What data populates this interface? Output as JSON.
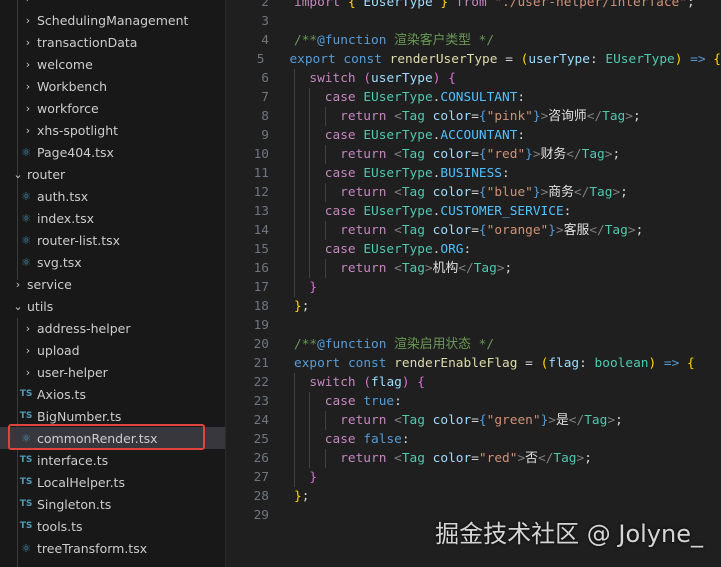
{
  "explorer": {
    "items": [
      {
        "label": "",
        "kind": "folder",
        "level": 2,
        "open": false
      },
      {
        "label": "SchedulingManagement",
        "kind": "folder",
        "level": 2,
        "open": false
      },
      {
        "label": "transactionData",
        "kind": "folder",
        "level": 2,
        "open": false
      },
      {
        "label": "welcome",
        "kind": "folder",
        "level": 2,
        "open": false
      },
      {
        "label": "Workbench",
        "kind": "folder",
        "level": 2,
        "open": false
      },
      {
        "label": "workforce",
        "kind": "folder",
        "level": 2,
        "open": false
      },
      {
        "label": "xhs-spotlight",
        "kind": "folder",
        "level": 2,
        "open": false
      },
      {
        "label": "Page404.tsx",
        "kind": "react",
        "level": 2
      },
      {
        "label": "router",
        "kind": "folder",
        "level": 1,
        "open": true
      },
      {
        "label": "auth.tsx",
        "kind": "react",
        "level": 2
      },
      {
        "label": "index.tsx",
        "kind": "react",
        "level": 2
      },
      {
        "label": "router-list.tsx",
        "kind": "react",
        "level": 2
      },
      {
        "label": "svg.tsx",
        "kind": "react",
        "level": 2
      },
      {
        "label": "service",
        "kind": "folder",
        "level": 1,
        "open": false
      },
      {
        "label": "utils",
        "kind": "folder",
        "level": 1,
        "open": true
      },
      {
        "label": "address-helper",
        "kind": "folder",
        "level": 2,
        "open": false
      },
      {
        "label": "upload",
        "kind": "folder",
        "level": 2,
        "open": false
      },
      {
        "label": "user-helper",
        "kind": "folder",
        "level": 2,
        "open": false
      },
      {
        "label": "Axios.ts",
        "kind": "ts",
        "level": 2
      },
      {
        "label": "BigNumber.ts",
        "kind": "ts",
        "level": 2
      },
      {
        "label": "commonRender.tsx",
        "kind": "react",
        "level": 2,
        "selected": true
      },
      {
        "label": "interface.ts",
        "kind": "ts",
        "level": 2
      },
      {
        "label": "LocalHelper.ts",
        "kind": "ts",
        "level": 2
      },
      {
        "label": "Singleton.ts",
        "kind": "ts",
        "level": 2
      },
      {
        "label": "tools.ts",
        "kind": "ts",
        "level": 2
      },
      {
        "label": "treeTransform.tsx",
        "kind": "react",
        "level": 2
      }
    ]
  },
  "editor": {
    "lines": [
      {
        "n": 2,
        "ind": 0,
        "tokens": [
          [
            "k",
            "import "
          ],
          [
            "b1",
            "{ "
          ],
          [
            "v",
            "EUserType"
          ],
          [
            "b1",
            " }"
          ],
          [
            "k",
            " from "
          ],
          [
            "str",
            "\"./user-helper/interface\""
          ],
          [
            "p",
            ";"
          ]
        ]
      },
      {
        "n": 3,
        "ind": 0,
        "tokens": []
      },
      {
        "n": 4,
        "ind": 0,
        "tokens": [
          [
            "cm",
            "/**"
          ],
          [
            "ct",
            "@function"
          ],
          [
            "cm",
            " 渲染客户类型 */"
          ]
        ]
      },
      {
        "n": 5,
        "ind": 0,
        "tokens": [
          [
            "s",
            "export "
          ],
          [
            "s",
            "const "
          ],
          [
            "f",
            "renderUserType"
          ],
          [
            "p",
            " = "
          ],
          [
            "b1",
            "("
          ],
          [
            "v",
            "userType"
          ],
          [
            "p",
            ": "
          ],
          [
            "t",
            "EUserType"
          ],
          [
            "b1",
            ")"
          ],
          [
            "s",
            " => "
          ],
          [
            "b1",
            "{"
          ]
        ]
      },
      {
        "n": 6,
        "ind": 1,
        "tokens": [
          [
            "k",
            "switch "
          ],
          [
            "b2",
            "("
          ],
          [
            "v",
            "userType"
          ],
          [
            "b2",
            ")"
          ],
          [
            "b2",
            " {"
          ]
        ]
      },
      {
        "n": 7,
        "ind": 2,
        "tokens": [
          [
            "k",
            "case "
          ],
          [
            "t",
            "EUserType"
          ],
          [
            "p",
            "."
          ],
          [
            "c",
            "CONSULTANT"
          ],
          [
            "p",
            ":"
          ]
        ]
      },
      {
        "n": 8,
        "ind": 3,
        "tokens": [
          [
            "k",
            "return "
          ],
          [
            "tg",
            "<"
          ],
          [
            "t",
            "Tag "
          ],
          [
            "v",
            "color"
          ],
          [
            "p",
            "="
          ],
          [
            "s",
            "{"
          ],
          [
            "str",
            "\"pink\""
          ],
          [
            "s",
            "}"
          ],
          [
            "tg",
            ">"
          ],
          [
            "cn",
            "咨询师"
          ],
          [
            "tg",
            "</"
          ],
          [
            "t",
            "Tag"
          ],
          [
            "tg",
            ">"
          ],
          [
            "p",
            ";"
          ]
        ]
      },
      {
        "n": 9,
        "ind": 2,
        "tokens": [
          [
            "k",
            "case "
          ],
          [
            "t",
            "EUserType"
          ],
          [
            "p",
            "."
          ],
          [
            "c",
            "ACCOUNTANT"
          ],
          [
            "p",
            ":"
          ]
        ]
      },
      {
        "n": 10,
        "ind": 3,
        "tokens": [
          [
            "k",
            "return "
          ],
          [
            "tg",
            "<"
          ],
          [
            "t",
            "Tag "
          ],
          [
            "v",
            "color"
          ],
          [
            "p",
            "="
          ],
          [
            "s",
            "{"
          ],
          [
            "str",
            "\"red\""
          ],
          [
            "s",
            "}"
          ],
          [
            "tg",
            ">"
          ],
          [
            "cn",
            "财务"
          ],
          [
            "tg",
            "</"
          ],
          [
            "t",
            "Tag"
          ],
          [
            "tg",
            ">"
          ],
          [
            "p",
            ";"
          ]
        ]
      },
      {
        "n": 11,
        "ind": 2,
        "tokens": [
          [
            "k",
            "case "
          ],
          [
            "t",
            "EUserType"
          ],
          [
            "p",
            "."
          ],
          [
            "c",
            "BUSINESS"
          ],
          [
            "p",
            ":"
          ]
        ]
      },
      {
        "n": 12,
        "ind": 3,
        "tokens": [
          [
            "k",
            "return "
          ],
          [
            "tg",
            "<"
          ],
          [
            "t",
            "Tag "
          ],
          [
            "v",
            "color"
          ],
          [
            "p",
            "="
          ],
          [
            "s",
            "{"
          ],
          [
            "str",
            "\"blue\""
          ],
          [
            "s",
            "}"
          ],
          [
            "tg",
            ">"
          ],
          [
            "cn",
            "商务"
          ],
          [
            "tg",
            "</"
          ],
          [
            "t",
            "Tag"
          ],
          [
            "tg",
            ">"
          ],
          [
            "p",
            ";"
          ]
        ]
      },
      {
        "n": 13,
        "ind": 2,
        "tokens": [
          [
            "k",
            "case "
          ],
          [
            "t",
            "EUserType"
          ],
          [
            "p",
            "."
          ],
          [
            "c",
            "CUSTOMER_SERVICE"
          ],
          [
            "p",
            ":"
          ]
        ]
      },
      {
        "n": 14,
        "ind": 3,
        "tokens": [
          [
            "k",
            "return "
          ],
          [
            "tg",
            "<"
          ],
          [
            "t",
            "Tag "
          ],
          [
            "v",
            "color"
          ],
          [
            "p",
            "="
          ],
          [
            "s",
            "{"
          ],
          [
            "str",
            "\"orange\""
          ],
          [
            "s",
            "}"
          ],
          [
            "tg",
            ">"
          ],
          [
            "cn",
            "客服"
          ],
          [
            "tg",
            "</"
          ],
          [
            "t",
            "Tag"
          ],
          [
            "tg",
            ">"
          ],
          [
            "p",
            ";"
          ]
        ]
      },
      {
        "n": 15,
        "ind": 2,
        "tokens": [
          [
            "k",
            "case "
          ],
          [
            "t",
            "EUserType"
          ],
          [
            "p",
            "."
          ],
          [
            "c",
            "ORG"
          ],
          [
            "p",
            ":"
          ]
        ]
      },
      {
        "n": 16,
        "ind": 3,
        "tokens": [
          [
            "k",
            "return "
          ],
          [
            "tg",
            "<"
          ],
          [
            "t",
            "Tag"
          ],
          [
            "tg",
            ">"
          ],
          [
            "cn",
            "机构"
          ],
          [
            "tg",
            "</"
          ],
          [
            "t",
            "Tag"
          ],
          [
            "tg",
            ">"
          ],
          [
            "p",
            ";"
          ]
        ]
      },
      {
        "n": 17,
        "ind": 1,
        "tokens": [
          [
            "b2",
            "}"
          ]
        ]
      },
      {
        "n": 18,
        "ind": 0,
        "tokens": [
          [
            "b1",
            "}"
          ],
          [
            "p",
            ";"
          ]
        ]
      },
      {
        "n": 19,
        "ind": 0,
        "tokens": []
      },
      {
        "n": 20,
        "ind": 0,
        "tokens": [
          [
            "cm",
            "/**"
          ],
          [
            "ct",
            "@function"
          ],
          [
            "cm",
            " 渲染启用状态 */"
          ]
        ]
      },
      {
        "n": 21,
        "ind": 0,
        "tokens": [
          [
            "s",
            "export "
          ],
          [
            "s",
            "const "
          ],
          [
            "f",
            "renderEnableFlag"
          ],
          [
            "p",
            " = "
          ],
          [
            "b1",
            "("
          ],
          [
            "v",
            "flag"
          ],
          [
            "p",
            ": "
          ],
          [
            "t",
            "boolean"
          ],
          [
            "b1",
            ")"
          ],
          [
            "s",
            " => "
          ],
          [
            "b1",
            "{"
          ]
        ]
      },
      {
        "n": 22,
        "ind": 1,
        "tokens": [
          [
            "k",
            "switch "
          ],
          [
            "b2",
            "("
          ],
          [
            "v",
            "flag"
          ],
          [
            "b2",
            ")"
          ],
          [
            "b2",
            " {"
          ]
        ]
      },
      {
        "n": 23,
        "ind": 2,
        "tokens": [
          [
            "k",
            "case "
          ],
          [
            "s",
            "true"
          ],
          [
            "p",
            ":"
          ]
        ]
      },
      {
        "n": 24,
        "ind": 3,
        "tokens": [
          [
            "k",
            "return "
          ],
          [
            "tg",
            "<"
          ],
          [
            "t",
            "Tag "
          ],
          [
            "v",
            "color"
          ],
          [
            "p",
            "="
          ],
          [
            "s",
            "{"
          ],
          [
            "str",
            "\"green\""
          ],
          [
            "s",
            "}"
          ],
          [
            "tg",
            ">"
          ],
          [
            "cn",
            "是"
          ],
          [
            "tg",
            "</"
          ],
          [
            "t",
            "Tag"
          ],
          [
            "tg",
            ">"
          ],
          [
            "p",
            ";"
          ]
        ]
      },
      {
        "n": 25,
        "ind": 2,
        "tokens": [
          [
            "k",
            "case "
          ],
          [
            "s",
            "false"
          ],
          [
            "p",
            ":"
          ]
        ]
      },
      {
        "n": 26,
        "ind": 3,
        "tokens": [
          [
            "k",
            "return "
          ],
          [
            "tg",
            "<"
          ],
          [
            "t",
            "Tag "
          ],
          [
            "v",
            "color"
          ],
          [
            "p",
            "="
          ],
          [
            "str",
            "\"red\""
          ],
          [
            "tg",
            ">"
          ],
          [
            "cn",
            "否"
          ],
          [
            "tg",
            "</"
          ],
          [
            "t",
            "Tag"
          ],
          [
            "tg",
            ">"
          ],
          [
            "p",
            ";"
          ]
        ]
      },
      {
        "n": 27,
        "ind": 1,
        "tokens": [
          [
            "b2",
            "}"
          ]
        ]
      },
      {
        "n": 28,
        "ind": 0,
        "tokens": [
          [
            "b1",
            "}"
          ],
          [
            "p",
            ";"
          ]
        ]
      },
      {
        "n": 29,
        "ind": 0,
        "tokens": []
      }
    ]
  },
  "watermark": "掘金技术社区 @ Jolyne_"
}
